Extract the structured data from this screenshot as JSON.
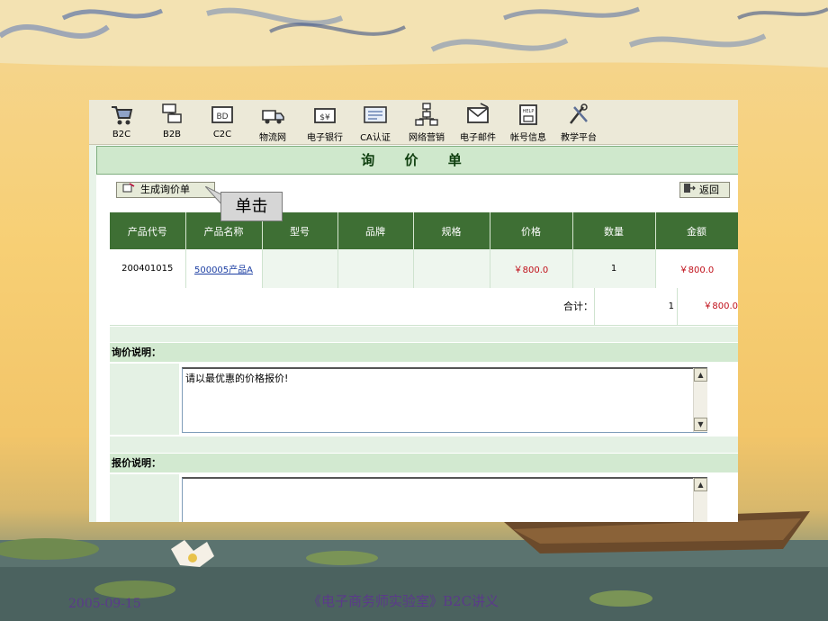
{
  "toolbar": {
    "items": [
      {
        "label": "B2C",
        "icon": "shopping-cart-icon"
      },
      {
        "label": "B2B",
        "icon": "network-icon"
      },
      {
        "label": "C2C",
        "icon": "cc-card-icon"
      },
      {
        "label": "物流网",
        "icon": "truck-icon"
      },
      {
        "label": "电子银行",
        "icon": "money-icon"
      },
      {
        "label": "CA认证",
        "icon": "certificate-icon"
      },
      {
        "label": "网络营销",
        "icon": "org-chart-icon"
      },
      {
        "label": "电子邮件",
        "icon": "mail-icon"
      },
      {
        "label": "帐号信息",
        "icon": "help-book-icon"
      },
      {
        "label": "教学平台",
        "icon": "tools-icon"
      }
    ]
  },
  "page": {
    "title": "询 价 单",
    "generate_button": "生成询价单",
    "back_button": "返回",
    "callout": "单击"
  },
  "table": {
    "headers": [
      "产品代号",
      "产品名称",
      "型号",
      "品牌",
      "规格",
      "价格",
      "数量",
      "金额"
    ],
    "rows": [
      {
        "code": "200401015",
        "name": "500005产品A",
        "model": "",
        "brand": "",
        "spec": "",
        "price": "￥800.0",
        "qty": "1",
        "amount": "￥800.0"
      }
    ],
    "total_label": "合计：",
    "total_qty": "1",
    "total_amount": "￥800.0"
  },
  "inquiry_note": {
    "label": "询价说明：",
    "value": "请以最优惠的价格报价!"
  },
  "quote_note": {
    "label": "报价说明：",
    "value": ""
  },
  "slide": {
    "date": "2005-09-15",
    "footer_title": "《电子商务师实验室》B2C讲义"
  },
  "colors": {
    "header_green": "#3e6f34",
    "price_red": "#c0101a",
    "title_bg": "#cfe8cc",
    "footer_text": "#5b3a8a"
  }
}
